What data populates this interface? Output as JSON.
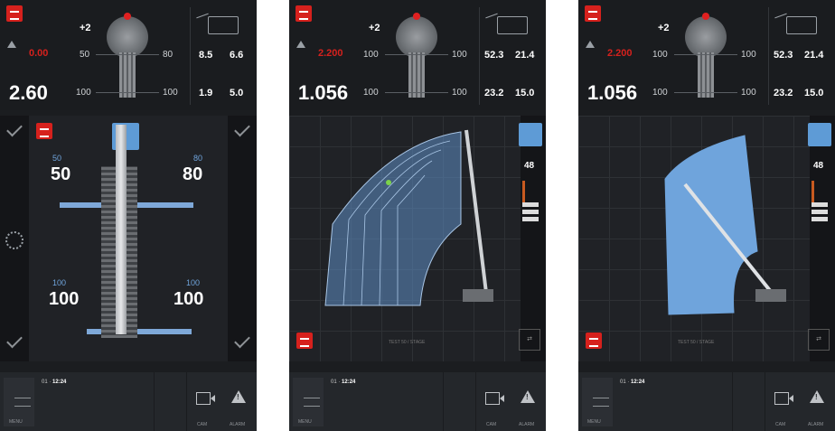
{
  "screens": [
    {
      "top": {
        "plus": "+2",
        "load_red": "0.00",
        "load_big": "2.60",
        "left_top": "50",
        "right_top": "80",
        "left_bottom": "100",
        "right_bottom": "100",
        "radius_a": "8.5",
        "radius_b": "6.6",
        "radius_c": "1.9",
        "radius_d": "5.0"
      },
      "main": {
        "ol_top_small": "50",
        "ol_top": "50",
        "or_top_small": "80",
        "or_top": "80",
        "ol_bot_small": "100",
        "ol_bot": "100",
        "or_bot_small": "100",
        "or_bot": "100"
      },
      "bottom": {
        "menu": "MENU",
        "date": "01",
        "time": "12:24",
        "cam": "CAM",
        "alarm": "ALARM"
      }
    },
    {
      "top": {
        "plus": "+2",
        "load_red": "2.200",
        "load_big": "1.056",
        "left_top": "100",
        "right_top": "100",
        "left_bottom": "100",
        "right_bottom": "100",
        "radius_a": "52.3",
        "radius_b": "21.4",
        "radius_c": "23.2",
        "radius_d": "15.0"
      },
      "main": {
        "limit": "48",
        "note": "TEST 50 / STAGE"
      },
      "bottom": {
        "menu": "MENU",
        "date": "01",
        "time": "12:24",
        "cam": "CAM",
        "alarm": "ALARM"
      }
    },
    {
      "top": {
        "plus": "+2",
        "load_red": "2.200",
        "load_big": "1.056",
        "left_top": "100",
        "right_top": "100",
        "left_bottom": "100",
        "right_bottom": "100",
        "radius_a": "52.3",
        "radius_b": "21.4",
        "radius_c": "23.2",
        "radius_d": "15.0"
      },
      "main": {
        "limit": "48",
        "note": "TEST 50 / STAGE"
      },
      "bottom": {
        "menu": "MENU",
        "date": "01",
        "time": "12:24",
        "cam": "CAM",
        "alarm": "ALARM"
      }
    }
  ],
  "colors": {
    "accent_red": "#d6211d",
    "outrigger_blue": "#7ea8d8",
    "chart_fill": "#6fa4dc"
  }
}
